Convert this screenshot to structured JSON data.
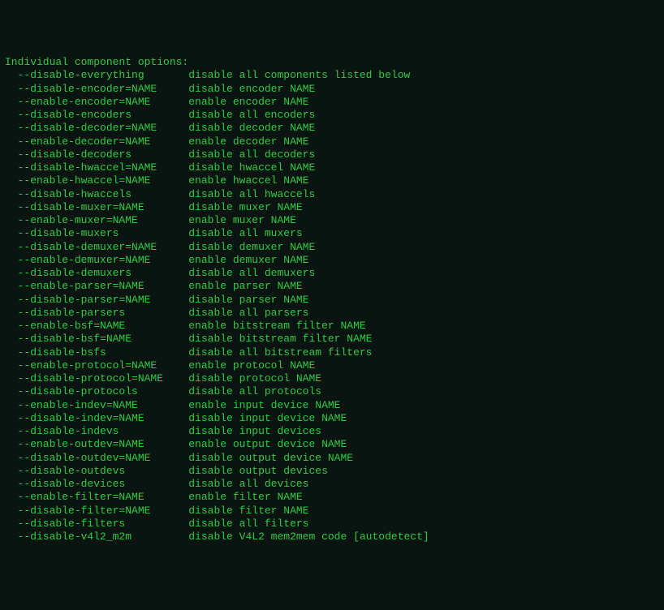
{
  "header": "Individual component options:",
  "rows": [
    {
      "flag": "--disable-everything",
      "desc": "disable all components listed below"
    },
    {
      "flag": "--disable-encoder=NAME",
      "desc": "disable encoder NAME"
    },
    {
      "flag": "--enable-encoder=NAME",
      "desc": "enable encoder NAME"
    },
    {
      "flag": "--disable-encoders",
      "desc": "disable all encoders"
    },
    {
      "flag": "--disable-decoder=NAME",
      "desc": "disable decoder NAME"
    },
    {
      "flag": "--enable-decoder=NAME",
      "desc": "enable decoder NAME"
    },
    {
      "flag": "--disable-decoders",
      "desc": "disable all decoders"
    },
    {
      "flag": "--disable-hwaccel=NAME",
      "desc": "disable hwaccel NAME"
    },
    {
      "flag": "--enable-hwaccel=NAME",
      "desc": "enable hwaccel NAME"
    },
    {
      "flag": "--disable-hwaccels",
      "desc": "disable all hwaccels"
    },
    {
      "flag": "--disable-muxer=NAME",
      "desc": "disable muxer NAME"
    },
    {
      "flag": "--enable-muxer=NAME",
      "desc": "enable muxer NAME"
    },
    {
      "flag": "--disable-muxers",
      "desc": "disable all muxers"
    },
    {
      "flag": "--disable-demuxer=NAME",
      "desc": "disable demuxer NAME"
    },
    {
      "flag": "--enable-demuxer=NAME",
      "desc": "enable demuxer NAME"
    },
    {
      "flag": "--disable-demuxers",
      "desc": "disable all demuxers"
    },
    {
      "flag": "--enable-parser=NAME",
      "desc": "enable parser NAME"
    },
    {
      "flag": "--disable-parser=NAME",
      "desc": "disable parser NAME"
    },
    {
      "flag": "--disable-parsers",
      "desc": "disable all parsers"
    },
    {
      "flag": "--enable-bsf=NAME",
      "desc": "enable bitstream filter NAME"
    },
    {
      "flag": "--disable-bsf=NAME",
      "desc": "disable bitstream filter NAME"
    },
    {
      "flag": "--disable-bsfs",
      "desc": "disable all bitstream filters"
    },
    {
      "flag": "--enable-protocol=NAME",
      "desc": "enable protocol NAME"
    },
    {
      "flag": "--disable-protocol=NAME",
      "desc": "disable protocol NAME"
    },
    {
      "flag": "--disable-protocols",
      "desc": "disable all protocols"
    },
    {
      "flag": "--enable-indev=NAME",
      "desc": "enable input device NAME"
    },
    {
      "flag": "--disable-indev=NAME",
      "desc": "disable input device NAME"
    },
    {
      "flag": "--disable-indevs",
      "desc": "disable input devices"
    },
    {
      "flag": "--enable-outdev=NAME",
      "desc": "enable output device NAME"
    },
    {
      "flag": "--disable-outdev=NAME",
      "desc": "disable output device NAME"
    },
    {
      "flag": "--disable-outdevs",
      "desc": "disable output devices"
    },
    {
      "flag": "--disable-devices",
      "desc": "disable all devices"
    },
    {
      "flag": "--enable-filter=NAME",
      "desc": "enable filter NAME"
    },
    {
      "flag": "--disable-filter=NAME",
      "desc": "disable filter NAME"
    },
    {
      "flag": "--disable-filters",
      "desc": "disable all filters"
    },
    {
      "flag": "--disable-v4l2_m2m",
      "desc": "disable V4L2 mem2mem code [autodetect]"
    }
  ],
  "indent": "  ",
  "flag_col_width": 27
}
